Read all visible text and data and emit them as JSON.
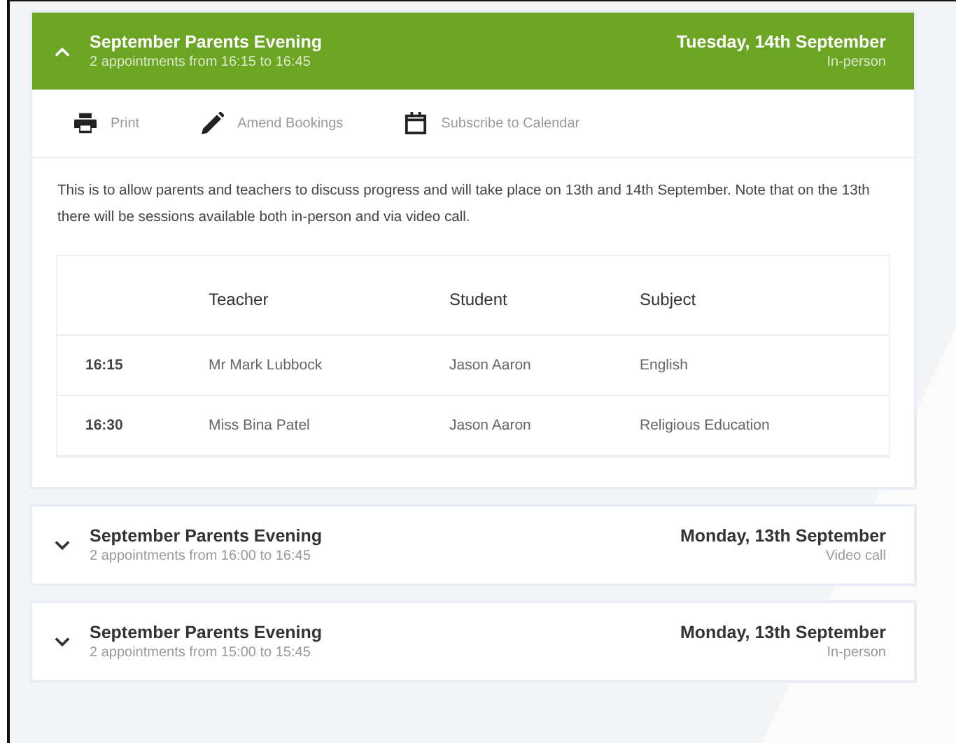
{
  "events": [
    {
      "title": "September Parents Evening",
      "summary": "2 appointments from 16:15 to 16:45",
      "date": "Tuesday, 14th September",
      "mode": "In-person",
      "expanded": true,
      "actions": [
        {
          "kind": "print",
          "label": "Print"
        },
        {
          "kind": "amend",
          "label": "Amend Bookings"
        },
        {
          "kind": "calendar",
          "label": "Subscribe to Calendar"
        }
      ],
      "description": "This is to allow parents and teachers to discuss progress and will take place on 13th and 14th September. Note that on the 13th there will be sessions available both in-person and via video call.",
      "table": {
        "columns": [
          "",
          "Teacher",
          "Student",
          "Subject"
        ],
        "rows": [
          [
            "16:15",
            "Mr Mark Lubbock",
            "Jason Aaron",
            "English"
          ],
          [
            "16:30",
            "Miss Bina Patel",
            "Jason Aaron",
            "Religious Education"
          ]
        ]
      }
    },
    {
      "title": "September Parents Evening",
      "summary": "2 appointments from 16:00 to 16:45",
      "date": "Monday, 13th September",
      "mode": "Video call",
      "expanded": false
    },
    {
      "title": "September Parents Evening",
      "summary": "2 appointments from 15:00 to 15:45",
      "date": "Monday, 13th September",
      "mode": "In-person",
      "expanded": false
    }
  ]
}
